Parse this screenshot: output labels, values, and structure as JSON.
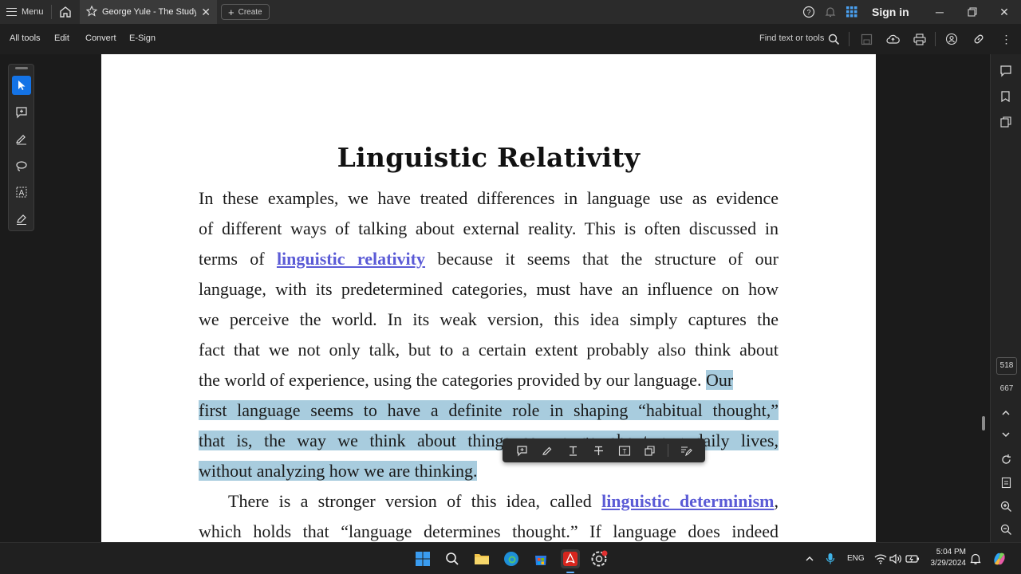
{
  "titlebar": {
    "menu_label": "Menu",
    "tab_title": "George Yule - The Study ...",
    "create_label": "Create",
    "signin_label": "Sign in"
  },
  "toolbar": {
    "items": [
      "All tools",
      "Edit",
      "Convert",
      "E-Sign"
    ],
    "find_label": "Find text or tools"
  },
  "document": {
    "title": "Linguistic Relativity",
    "lines": [
      {
        "pre": "In these examples, we have treated differences in language use as evidence"
      },
      {
        "pre": "of different ways of talking about external reality. This is often discussed in"
      },
      {
        "pre": "terms of ",
        "link": "linguistic relativity",
        "post": " because it seems that the structure of our"
      },
      {
        "pre": "language, with its predetermined categories, must have an influence on how"
      },
      {
        "pre": "we perceive the world. In its weak version, this idea simply captures the"
      },
      {
        "pre": "fact that we not only talk, but to a certain extent probably also think about"
      },
      {
        "pre": "the world of experience, using the categories provided by our language. ",
        "hl": "Our"
      },
      {
        "hl": "first language seems to have a definite role in shaping “habitual thought,”"
      },
      {
        "hl": "that is, the way we think about things as we go about our daily lives,"
      },
      {
        "hl": "without analyzing how we are thinking."
      },
      {
        "pre": "There is a stronger version of this idea, called ",
        "link": "linguistic determinism",
        "post": ","
      },
      {
        "pre": "which holds that “language determines thought.” If language does indeed"
      }
    ]
  },
  "rightrail": {
    "current_page": "518",
    "total_pages": "667"
  },
  "taskbar": {
    "lang": "ENG",
    "time": "5:04 PM",
    "date": "3/29/2024"
  },
  "colors": {
    "accent": "#1473e6",
    "highlight": "#a8ccde",
    "link": "#5b5bd6",
    "acrobat_red": "#d7261e"
  }
}
